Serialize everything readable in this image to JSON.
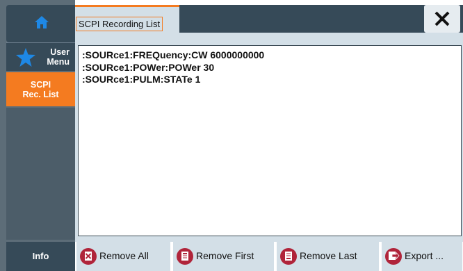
{
  "sidebar": {
    "home_icon": "home-icon",
    "user_menu": {
      "line1": "User",
      "line2": "Menu",
      "icon": "star-icon"
    },
    "scpi": {
      "line1": "SCPI",
      "line2": "Rec. List",
      "active_color": "#f47b20"
    },
    "info": "Info"
  },
  "header": {
    "tab_label": "SCPI Recording List",
    "close_icon": "close-icon"
  },
  "list": {
    "commands": [
      ":SOURce1:FREQuency:CW 6000000000",
      ":SOURce1:POWer:POWer 30",
      ":SOURce1:PULM:STATe 1"
    ]
  },
  "toolbar": {
    "remove_all": "Remove All",
    "remove_first": "Remove First",
    "remove_last": "Remove Last",
    "export": "Export ..."
  },
  "colors": {
    "accent": "#f47b20",
    "icon_red": "#b0243a",
    "panel": "#d3dfe7",
    "dark": "#364a58"
  }
}
